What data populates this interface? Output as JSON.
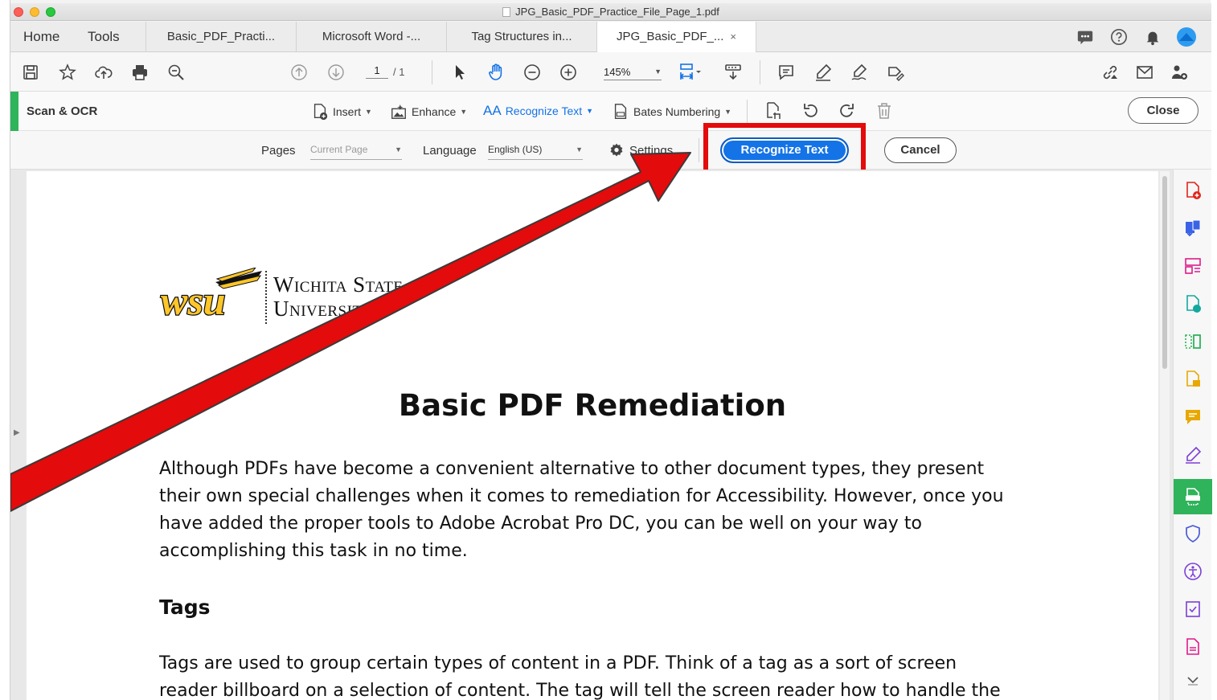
{
  "window": {
    "title": "JPG_Basic_PDF_Practice_File_Page_1.pdf"
  },
  "nav": {
    "home": "Home",
    "tools": "Tools"
  },
  "tabs": [
    {
      "label": "Basic_PDF_Practi..."
    },
    {
      "label": "Microsoft Word -..."
    },
    {
      "label": "Tag Structures in..."
    },
    {
      "label": "JPG_Basic_PDF_...",
      "close": "×"
    }
  ],
  "toolbar": {
    "page_current": "1",
    "page_total": "/ 1",
    "zoom": "145%"
  },
  "ocr": {
    "title": "Scan & OCR",
    "tools": {
      "insert": "Insert",
      "enhance": "Enhance",
      "recognize": "Recognize Text",
      "bates": "Bates Numbering"
    },
    "close_label": "Close"
  },
  "options": {
    "pages_label": "Pages",
    "pages_value": "Current Page",
    "language_label": "Language",
    "language_value": "English (US)",
    "settings_label": "Settings",
    "recognize_button": "Recognize Text",
    "cancel_button": "Cancel"
  },
  "document": {
    "logo_line1": "Wichita State",
    "logo_line2": "University",
    "heading": "Basic PDF Remediation",
    "para1_lines": [
      "Although PDFs have become a convenient alternative to other document types, they present",
      "their own special challenges when it comes to remediation for Accessibility. However, once you",
      "have added the proper tools to Adobe Acrobat Pro DC, you can be well on your way to",
      "accomplishing this task in no time."
    ],
    "subheading": "Tags",
    "para2_lines": [
      "Tags are used to group certain types of content in a PDF. Think of a tag as a sort of screen",
      "reader billboard on a selection of content. The tag will tell the screen reader how to handle the"
    ]
  },
  "colors": {
    "accent_blue": "#1473e6",
    "highlight_red": "#e30b0b",
    "tool_green": "#2fb35b"
  }
}
